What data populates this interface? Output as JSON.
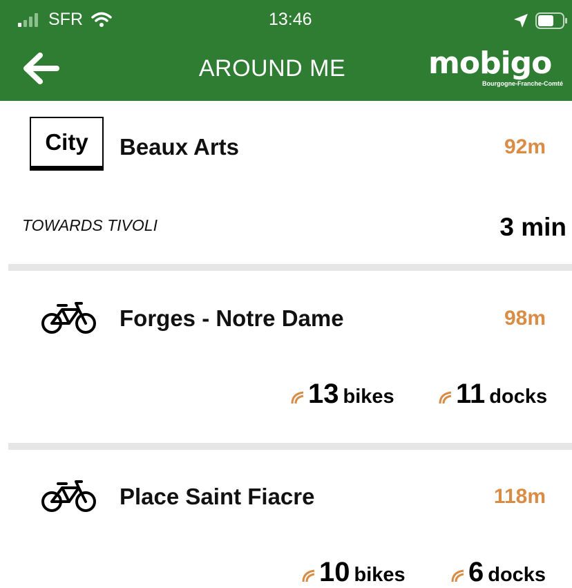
{
  "status_bar": {
    "carrier": "SFR",
    "time": "13:46"
  },
  "header": {
    "title": "AROUND ME",
    "logo_text": "mobigo",
    "logo_subtitle": "Bourgogne-Franche-Comté"
  },
  "colors": {
    "header_bg": "#2e7d32",
    "distance": "#d98c45",
    "divider": "#e6e6e6"
  },
  "stops": [
    {
      "type": "bus",
      "line_label": "City",
      "name": "Beaux Arts",
      "distance": "92m",
      "direction": "TOWARDS TIVOLI",
      "wait": "3 min"
    },
    {
      "type": "bike",
      "icon": "bicycle-icon",
      "name": "Forges - Notre Dame",
      "distance": "98m",
      "bikes": "13",
      "bikes_label": "bikes",
      "docks": "11",
      "docks_label": "docks"
    },
    {
      "type": "bike",
      "icon": "bicycle-icon",
      "name": "Place Saint Fiacre",
      "distance": "118m",
      "bikes": "10",
      "bikes_label": "bikes",
      "docks": "6",
      "docks_label": "docks"
    }
  ]
}
